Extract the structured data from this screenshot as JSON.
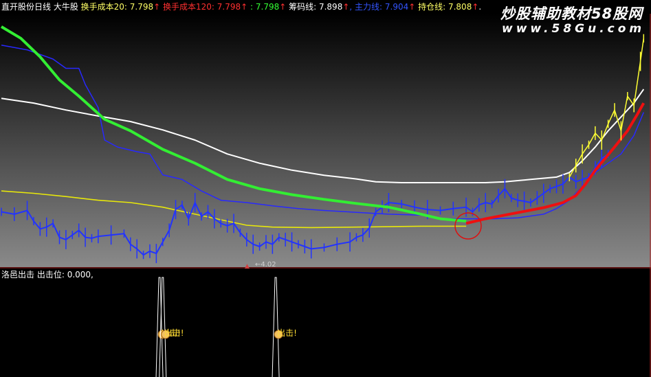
{
  "header": {
    "segments": [
      {
        "text": "直开股份日线",
        "color": "#ffffff"
      },
      {
        "text": "  大牛股",
        "color": "#ffffff"
      },
      {
        "text": "  换手成本20: 7.798",
        "color": "#ffff66"
      },
      {
        "text": "↑",
        "color": "#ff3030"
      },
      {
        "text": "  换手成本120: 7.798",
        "color": "#ff3030"
      },
      {
        "text": "↑",
        "color": "#ff3030"
      },
      {
        "text": "  : 7.798",
        "color": "#33ff33"
      },
      {
        "text": "↑",
        "color": "#ff3030"
      },
      {
        "text": "  筹码线: 7.898",
        "color": "#ffffff"
      },
      {
        "text": "↑",
        "color": "#ff3030"
      },
      {
        "text": ", 主力线: 7.904",
        "color": "#3355ff"
      },
      {
        "text": "↑",
        "color": "#ff3030"
      },
      {
        "text": "  持仓线: 7.808",
        "color": "#ffff66"
      },
      {
        "text": "↑",
        "color": "#ff3030"
      },
      {
        "text": ".",
        "color": "#ffffff"
      }
    ]
  },
  "subheader": {
    "title": "洛邑出击",
    "field": "  出击位: 0.000,",
    "title_color": "#ffffff",
    "field_color": "#ffffff"
  },
  "watermark": {
    "line1": "炒股辅助教材58股网",
    "line2": "www.58Gu.com"
  },
  "low_label": "←4.02",
  "signal_label": "出击!",
  "chart_data": [
    {
      "type": "line",
      "panel": "price",
      "x_range": [
        0,
        100
      ],
      "ylim": [
        3.6,
        9.0
      ],
      "series": [
        {
          "key": "white",
          "color": "#ffffff",
          "points": [
            [
              0,
              7.2
            ],
            [
              5,
              7.1
            ],
            [
              10,
              6.95
            ],
            [
              15,
              6.82
            ],
            [
              20,
              6.7
            ],
            [
              25,
              6.52
            ],
            [
              30,
              6.3
            ],
            [
              35,
              6.0
            ],
            [
              40,
              5.8
            ],
            [
              45,
              5.65
            ],
            [
              50,
              5.54
            ],
            [
              55,
              5.46
            ],
            [
              58,
              5.4
            ],
            [
              62,
              5.38
            ],
            [
              66,
              5.38
            ],
            [
              70,
              5.38
            ],
            [
              75,
              5.38
            ],
            [
              78,
              5.4
            ],
            [
              82,
              5.45
            ],
            [
              86,
              5.5
            ],
            [
              88,
              5.6
            ],
            [
              90,
              5.85
            ],
            [
              92,
              6.15
            ],
            [
              94,
              6.5
            ],
            [
              96,
              6.8
            ],
            [
              98,
              7.1
            ],
            [
              99.5,
              7.4
            ]
          ]
        },
        {
          "key": "green",
          "color": "#33ee33",
          "points": [
            [
              0,
              8.75
            ],
            [
              3,
              8.5
            ],
            [
              6,
              8.1
            ],
            [
              9,
              7.6
            ],
            [
              12,
              7.25
            ],
            [
              16,
              6.75
            ],
            [
              20,
              6.5
            ],
            [
              25,
              6.1
            ],
            [
              30,
              5.8
            ],
            [
              35,
              5.45
            ],
            [
              40,
              5.25
            ],
            [
              45,
              5.12
            ],
            [
              50,
              5.02
            ],
            [
              55,
              4.93
            ],
            [
              60,
              4.85
            ],
            [
              65,
              4.7
            ],
            [
              68,
              4.6
            ],
            [
              72,
              4.55
            ]
          ]
        },
        {
          "key": "blue_cost",
          "color": "#2828ff",
          "points": [
            [
              0,
              8.35
            ],
            [
              4,
              8.25
            ],
            [
              8,
              8.05
            ],
            [
              10,
              7.85
            ],
            [
              12,
              7.85
            ],
            [
              13,
              7.5
            ],
            [
              15,
              7.0
            ],
            [
              16,
              6.3
            ],
            [
              18,
              6.15
            ],
            [
              21,
              6.05
            ],
            [
              23,
              6.0
            ],
            [
              25,
              5.55
            ],
            [
              28,
              5.45
            ],
            [
              31,
              5.2
            ],
            [
              34,
              5.0
            ],
            [
              38,
              4.95
            ],
            [
              42,
              4.88
            ],
            [
              46,
              4.82
            ],
            [
              50,
              4.78
            ],
            [
              55,
              4.74
            ],
            [
              60,
              4.7
            ],
            [
              65,
              4.68
            ],
            [
              68,
              4.6
            ],
            [
              70,
              4.6
            ],
            [
              72,
              4.6
            ],
            [
              76,
              4.6
            ],
            [
              80,
              4.62
            ],
            [
              84,
              4.7
            ],
            [
              86,
              4.82
            ],
            [
              88,
              5.0
            ],
            [
              90,
              5.3
            ],
            [
              92,
              5.6
            ],
            [
              94,
              5.8
            ],
            [
              96,
              6.0
            ],
            [
              98,
              6.4
            ],
            [
              99.5,
              6.9
            ]
          ]
        },
        {
          "key": "yellow",
          "color": "#e8e80a",
          "points": [
            [
              0,
              5.2
            ],
            [
              5,
              5.15
            ],
            [
              10,
              5.08
            ],
            [
              15,
              5.0
            ],
            [
              20,
              4.95
            ],
            [
              25,
              4.85
            ],
            [
              30,
              4.7
            ],
            [
              35,
              4.55
            ],
            [
              38,
              4.46
            ],
            [
              42,
              4.42
            ],
            [
              48,
              4.41
            ],
            [
              55,
              4.42
            ],
            [
              60,
              4.43
            ],
            [
              65,
              4.44
            ],
            [
              68,
              4.44
            ],
            [
              72,
              4.44
            ]
          ]
        },
        {
          "key": "red",
          "color": "#ee1010",
          "points": [
            [
              72,
              4.5
            ],
            [
              75,
              4.6
            ],
            [
              78,
              4.68
            ],
            [
              81,
              4.76
            ],
            [
              84,
              4.84
            ],
            [
              87,
              4.95
            ],
            [
              89,
              5.1
            ],
            [
              90.5,
              5.35
            ],
            [
              92,
              5.65
            ],
            [
              93.5,
              5.9
            ],
            [
              95,
              6.15
            ],
            [
              97,
              6.5
            ],
            [
              98.5,
              6.85
            ],
            [
              99.5,
              7.1
            ]
          ]
        },
        {
          "key": "blue_price",
          "color": "#2233ff",
          "points": [
            [
              0,
              4.75
            ],
            [
              2,
              4.7
            ],
            [
              4,
              4.78
            ],
            [
              5,
              4.55
            ],
            [
              6,
              4.38
            ],
            [
              7,
              4.42
            ],
            [
              8,
              4.5
            ],
            [
              9,
              4.2
            ],
            [
              10,
              4.15
            ],
            [
              11,
              4.25
            ],
            [
              12,
              4.35
            ],
            [
              13,
              4.2
            ],
            [
              14,
              4.18
            ],
            [
              15,
              4.22
            ],
            [
              17,
              4.25
            ],
            [
              19,
              4.28
            ],
            [
              20,
              4.05
            ],
            [
              21,
              3.95
            ],
            [
              22,
              3.82
            ],
            [
              23,
              3.9
            ],
            [
              24,
              3.85
            ],
            [
              25,
              4.1
            ],
            [
              26,
              4.35
            ],
            [
              27,
              4.8
            ],
            [
              28,
              4.9
            ],
            [
              29,
              4.6
            ],
            [
              30,
              4.95
            ],
            [
              31,
              4.65
            ],
            [
              32,
              4.75
            ],
            [
              33,
              4.6
            ],
            [
              34,
              4.5
            ],
            [
              35,
              4.45
            ],
            [
              36,
              4.5
            ],
            [
              37,
              4.3
            ],
            [
              38,
              4.15
            ],
            [
              39,
              4.05
            ],
            [
              40,
              4.0
            ],
            [
              41,
              4.1
            ],
            [
              42,
              4.05
            ],
            [
              43,
              4.2
            ],
            [
              44,
              4.15
            ],
            [
              45,
              4.1
            ],
            [
              46,
              4.05
            ],
            [
              47,
              4.0
            ],
            [
              48,
              3.95
            ],
            [
              50,
              3.98
            ],
            [
              52,
              4.05
            ],
            [
              54,
              4.1
            ],
            [
              55,
              4.2
            ],
            [
              56,
              4.25
            ],
            [
              57,
              4.4
            ],
            [
              58,
              4.75
            ],
            [
              59,
              4.85
            ],
            [
              60,
              4.95
            ],
            [
              62,
              4.92
            ],
            [
              64,
              4.85
            ],
            [
              66,
              4.8
            ],
            [
              68,
              4.78
            ],
            [
              70,
              4.82
            ],
            [
              72,
              4.85
            ],
            [
              73,
              4.75
            ],
            [
              74,
              4.9
            ],
            [
              75,
              4.95
            ],
            [
              76,
              4.92
            ],
            [
              77,
              5.1
            ],
            [
              78,
              5.25
            ],
            [
              79,
              5.05
            ],
            [
              80,
              5.0
            ],
            [
              81,
              4.98
            ],
            [
              82,
              4.95
            ],
            [
              83,
              5.05
            ],
            [
              84,
              5.15
            ],
            [
              85,
              5.25
            ],
            [
              86,
              5.3
            ],
            [
              87,
              5.35
            ],
            [
              88,
              5.5
            ],
            [
              89,
              5.4
            ],
            [
              90,
              5.45
            ],
            [
              91,
              5.5
            ],
            [
              92,
              5.7
            ],
            [
              93,
              5.9
            ],
            [
              94,
              6.0
            ]
          ]
        },
        {
          "key": "yellow_price",
          "color": "#ffff33",
          "points": [
            [
              88,
              5.5
            ],
            [
              89,
              5.75
            ],
            [
              90,
              6.0
            ],
            [
              91,
              6.2
            ],
            [
              92,
              6.45
            ],
            [
              93,
              6.3
            ],
            [
              94,
              6.65
            ],
            [
              95,
              6.95
            ],
            [
              96,
              6.5
            ],
            [
              97,
              7.25
            ],
            [
              98,
              7.05
            ],
            [
              99,
              8.0
            ],
            [
              99.5,
              8.5
            ]
          ]
        }
      ]
    },
    {
      "type": "line",
      "panel": "signal",
      "x_range": [
        0,
        100
      ],
      "ylim": [
        0,
        1
      ],
      "series": [
        {
          "key": "signal",
          "color": "#ffffff",
          "spikes": [
            24.5,
            25.0,
            42.5
          ]
        }
      ]
    }
  ]
}
